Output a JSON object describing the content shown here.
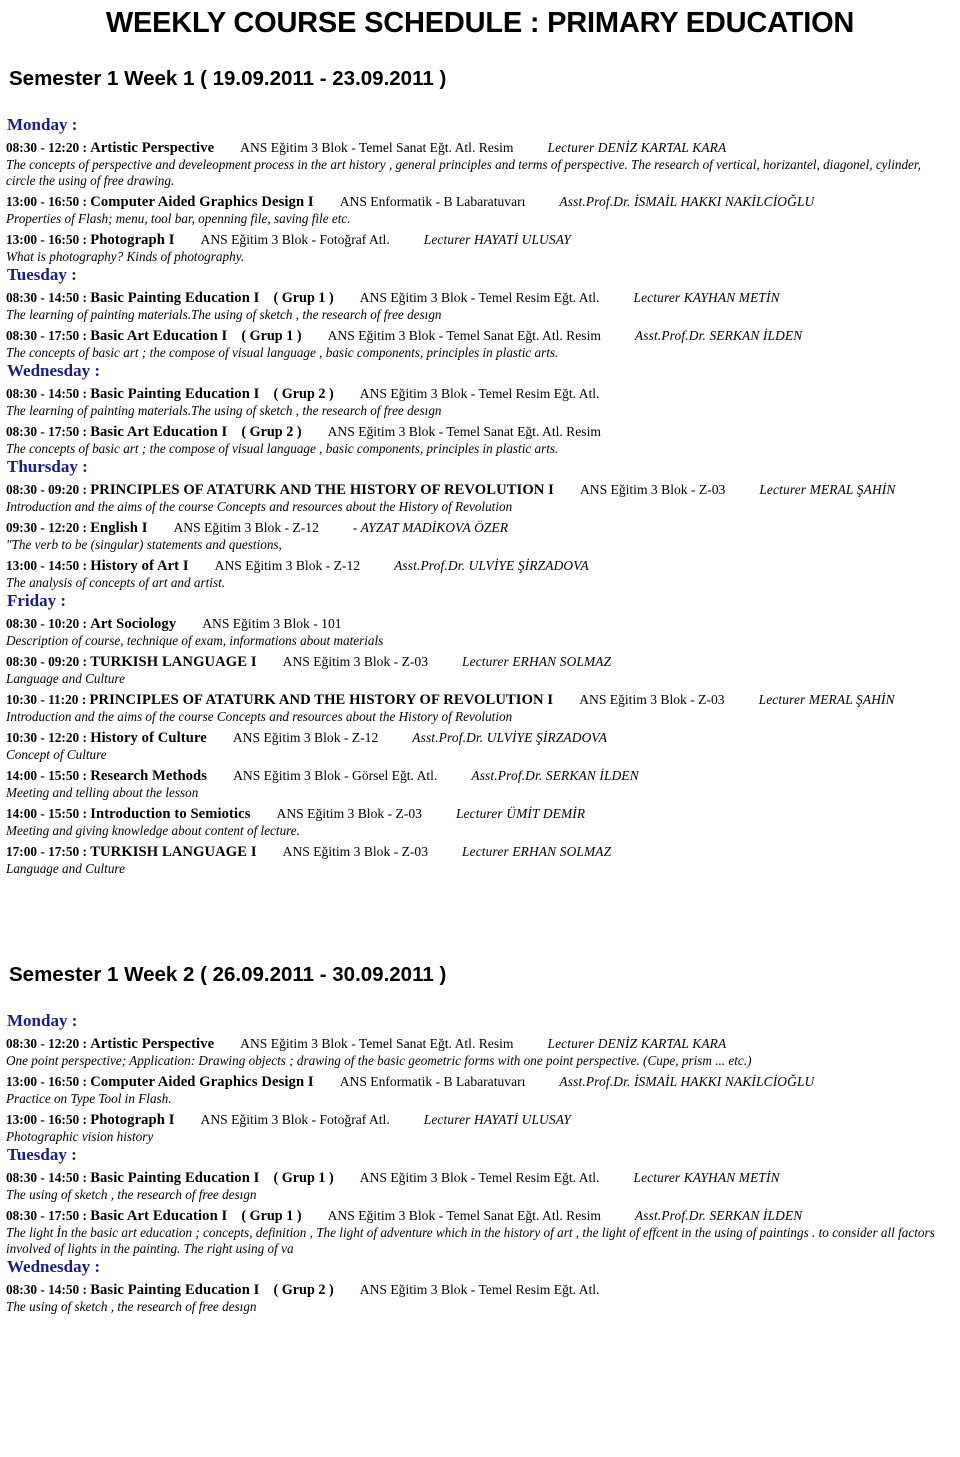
{
  "document": {
    "title": "WEEKLY COURSE SCHEDULE : PRIMARY EDUCATION",
    "accent_color": "#1c1c8e",
    "text_color": "#000000",
    "background": "#ffffff"
  },
  "weeks": [
    {
      "heading": "Semester 1 Week 1 ( 19.09.2011 - 23.09.2011 )",
      "days": [
        {
          "label": "Monday :",
          "courses": [
            {
              "time": "08:30 - 12:20 :",
              "name": "Artistic Perspective",
              "group": "",
              "room": "ANS Eğitim 3 Blok - Temel Sanat Eğt. Atl. Resim",
              "lecturer": "Lecturer DENİZ KARTAL KARA",
              "description": "The concepts of perspective and develeopment process in the art history , general principles and terms of perspective. The research of vertical, horizantel, diagonel, cylinder, circle the using of free drawing."
            },
            {
              "time": "13:00 - 16:50 :",
              "name": "Computer Aided Graphics Design I",
              "group": "",
              "room": "ANS Enformatik - B Labaratuvarı",
              "lecturer": "Asst.Prof.Dr. İSMAİL HAKKI NAKİLCİOĞLU",
              "description": "Properties of Flash; menu, tool bar, openning file, saving file etc."
            },
            {
              "time": "13:00 - 16:50 :",
              "name": "Photograph I",
              "group": "",
              "room": "ANS Eğitim 3 Blok - Fotoğraf Atl.",
              "lecturer": "Lecturer HAYATİ ULUSAY",
              "description": "What is photography? Kinds of photography."
            }
          ]
        },
        {
          "label": "Tuesday :",
          "courses": [
            {
              "time": "08:30 - 14:50 :",
              "name": "Basic Painting Education I",
              "group": "( Grup 1 )",
              "room": "ANS Eğitim 3 Blok - Temel Resim Eğt. Atl.",
              "lecturer": "Lecturer KAYHAN METİN",
              "description": "The learning of painting materials.The using of sketch , the research of free desıgn"
            },
            {
              "time": "08:30 - 17:50 :",
              "name": "Basic Art Education I",
              "group": "( Grup 1 )",
              "room": "ANS Eğitim 3 Blok - Temel Sanat Eğt. Atl. Resim",
              "lecturer": "Asst.Prof.Dr. SERKAN İLDEN",
              "description": "The concepts of basic art ; the compose of visual language , basic components, principles in plastic arts."
            }
          ]
        },
        {
          "label": "Wednesday :",
          "courses": [
            {
              "time": "08:30 - 14:50 :",
              "name": "Basic Painting Education I",
              "group": "( Grup 2 )",
              "room": "ANS Eğitim 3 Blok - Temel Resim Eğt. Atl.",
              "lecturer": "",
              "description": "The learning of painting materials.The using of sketch , the research of free desıgn"
            },
            {
              "time": "08:30 - 17:50 :",
              "name": "Basic Art Education I",
              "group": "( Grup 2 )",
              "room": "ANS Eğitim 3 Blok - Temel Sanat Eğt. Atl. Resim",
              "lecturer": "",
              "description": "The concepts of basic art ; the compose of visual language , basic components, principles in plastic arts."
            }
          ]
        },
        {
          "label": "Thursday :",
          "courses": [
            {
              "time": "08:30 - 09:20 :",
              "name": "PRINCIPLES OF ATATURK AND THE HISTORY OF REVOLUTION I",
              "group": "",
              "room": "ANS Eğitim 3 Blok - Z-03",
              "lecturer": "Lecturer MERAL ŞAHİN",
              "description": "Introduction and the aims of the course Concepts and resources about the History of Revolution"
            },
            {
              "time": "09:30 - 12:20 :",
              "name": "English I",
              "group": "",
              "room": "ANS Eğitim 3 Blok - Z-12",
              "lecturer": "- AYZAT MADİKOVA ÖZER",
              "description": "\"The verb to be (singular) statements and questions,"
            },
            {
              "time": "13:00 - 14:50 :",
              "name": "History of Art I",
              "group": "",
              "room": "ANS Eğitim 3 Blok - Z-12",
              "lecturer": "Asst.Prof.Dr. ULVİYE ŞİRZADOVA",
              "description": "The analysis of concepts of art and artist."
            }
          ]
        },
        {
          "label": "Friday :",
          "courses": [
            {
              "time": "08:30 - 10:20 :",
              "name": "Art Sociology",
              "group": "",
              "room": "ANS Eğitim 3 Blok - 101",
              "lecturer": "",
              "description": "Description of course, technique of exam, informations about materials"
            },
            {
              "time": "08:30 - 09:20 :",
              "name": "TURKISH LANGUAGE I",
              "group": "",
              "room": "ANS Eğitim 3 Blok - Z-03",
              "lecturer": "Lecturer ERHAN SOLMAZ",
              "description": "Language and Culture"
            },
            {
              "time": "10:30 - 11:20 :",
              "name": "PRINCIPLES OF ATATURK AND THE HISTORY OF REVOLUTION I",
              "group": "",
              "room": "ANS Eğitim 3 Blok - Z-03",
              "lecturer": "Lecturer MERAL ŞAHİN",
              "description": "Introduction and the aims of the course Concepts and resources about the History of Revolution"
            },
            {
              "time": "10:30 - 12:20 :",
              "name": "History of Culture",
              "group": "",
              "room": "ANS Eğitim 3 Blok - Z-12",
              "lecturer": "Asst.Prof.Dr. ULVİYE ŞİRZADOVA",
              "description": "Concept of Culture"
            },
            {
              "time": "14:00 - 15:50 :",
              "name": "Research Methods",
              "group": "",
              "room": "ANS Eğitim 3 Blok - Görsel Eğt. Atl.",
              "lecturer": "Asst.Prof.Dr. SERKAN İLDEN",
              "description": "Meeting and telling about the lesson"
            },
            {
              "time": "14:00 - 15:50 :",
              "name": "Introduction to Semiotics",
              "group": "",
              "room": "ANS Eğitim 3 Blok - Z-03",
              "lecturer": "Lecturer ÜMİT DEMİR",
              "description": "Meeting and giving knowledge about content of lecture."
            },
            {
              "time": "17:00 - 17:50 :",
              "name": "TURKISH LANGUAGE I",
              "group": "",
              "room": "ANS Eğitim 3 Blok - Z-03",
              "lecturer": "Lecturer ERHAN SOLMAZ",
              "description": "Language and Culture"
            }
          ]
        }
      ]
    },
    {
      "heading": "Semester 1 Week 2 ( 26.09.2011 - 30.09.2011 )",
      "days": [
        {
          "label": "Monday :",
          "courses": [
            {
              "time": "08:30 - 12:20 :",
              "name": "Artistic Perspective",
              "group": "",
              "room": "ANS Eğitim 3 Blok - Temel Sanat Eğt. Atl. Resim",
              "lecturer": "Lecturer DENİZ KARTAL KARA",
              "description": "One point perspective; Application: Drawing objects ; drawing of the basic geometric forms with one point perspective. (Cupe, prism ... etc.)"
            },
            {
              "time": "13:00 - 16:50 :",
              "name": "Computer Aided Graphics Design I",
              "group": "",
              "room": "ANS Enformatik - B Labaratuvarı",
              "lecturer": "Asst.Prof.Dr. İSMAİL HAKKI NAKİLCİOĞLU",
              "description": "Practice on Type Tool in Flash."
            },
            {
              "time": "13:00 - 16:50 :",
              "name": "Photograph I",
              "group": "",
              "room": "ANS Eğitim 3 Blok - Fotoğraf Atl.",
              "lecturer": "Lecturer HAYATİ ULUSAY",
              "description": "Photographic vision history"
            }
          ]
        },
        {
          "label": "Tuesday :",
          "courses": [
            {
              "time": "08:30 - 14:50 :",
              "name": "Basic Painting Education I",
              "group": "( Grup 1 )",
              "room": "ANS Eğitim 3 Blok - Temel Resim Eğt. Atl.",
              "lecturer": "Lecturer KAYHAN METİN",
              "description": "The using of sketch , the research of free desıgn"
            },
            {
              "time": "08:30 - 17:50 :",
              "name": "Basic Art Education I",
              "group": "( Grup 1 )",
              "room": "ANS Eğitim 3 Blok - Temel Sanat Eğt. Atl. Resim",
              "lecturer": "Asst.Prof.Dr. SERKAN İLDEN",
              "description": "The light İn the basic art education ; concepts, definition , The light of adventure which in the history of art , the light of effcent in the using of paintings . to consider all factors involved of lights in the painting. The right using of va"
            }
          ]
        },
        {
          "label": "Wednesday :",
          "courses": [
            {
              "time": "08:30 - 14:50 :",
              "name": "Basic Painting Education I",
              "group": "( Grup 2 )",
              "room": "ANS Eğitim 3 Blok - Temel Resim Eğt. Atl.",
              "lecturer": "",
              "description": "The using of sketch , the research of free desıgn"
            }
          ]
        }
      ]
    }
  ]
}
